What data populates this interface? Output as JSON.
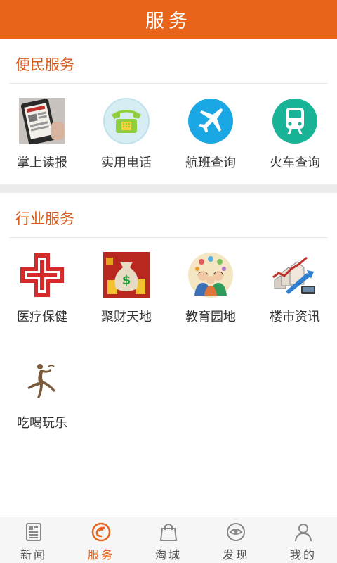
{
  "header": {
    "title": "服务"
  },
  "sections": [
    {
      "title": "便民服务",
      "items": [
        {
          "label": "掌上读报",
          "icon": "newspaper-phone-icon"
        },
        {
          "label": "实用电话",
          "icon": "telephone-icon"
        },
        {
          "label": "航班查询",
          "icon": "airplane-icon"
        },
        {
          "label": "火车查询",
          "icon": "train-icon"
        }
      ]
    },
    {
      "title": "行业服务",
      "items": [
        {
          "label": "医疗保健",
          "icon": "red-cross-icon"
        },
        {
          "label": "聚财天地",
          "icon": "money-bag-icon"
        },
        {
          "label": "教育园地",
          "icon": "students-icon"
        },
        {
          "label": "楼市资讯",
          "icon": "housing-chart-icon"
        },
        {
          "label": "吃喝玩乐",
          "icon": "leisure-figure-icon"
        }
      ]
    }
  ],
  "tabbar": {
    "active": "服务",
    "tabs": [
      {
        "label": "新闻",
        "icon": "news-icon"
      },
      {
        "label": "服务",
        "icon": "service-icon"
      },
      {
        "label": "淘城",
        "icon": "shopping-bag-icon"
      },
      {
        "label": "发现",
        "icon": "eye-icon"
      },
      {
        "label": "我的",
        "icon": "user-icon"
      }
    ]
  },
  "colors": {
    "primary": "#e8641b",
    "section_title": "#d9581b",
    "band": "#ececec"
  }
}
